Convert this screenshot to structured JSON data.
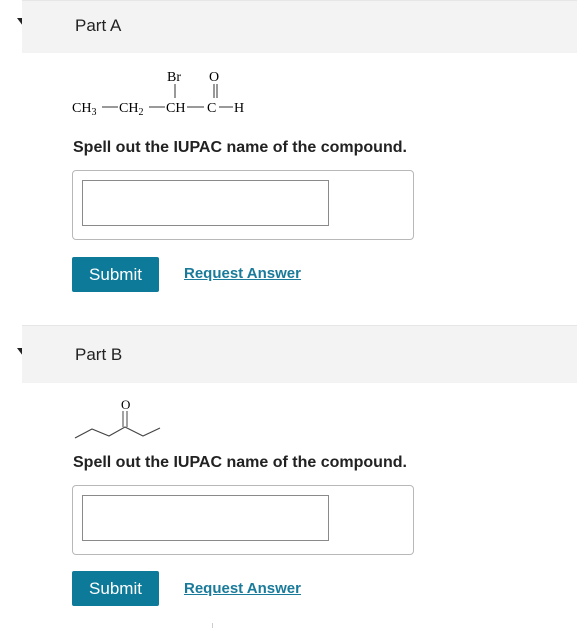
{
  "parts": [
    {
      "title": "Part A",
      "structure_labels": {
        "br": "Br",
        "o": "O",
        "ch3": "CH",
        "ch3_sub": "3",
        "ch2": "CH",
        "ch2_sub": "2",
        "ch": "CH",
        "c": "C",
        "h": "H"
      },
      "prompt": "Spell out the IUPAC name of the compound.",
      "input_value": "",
      "submit_label": "Submit",
      "request_label": "Request Answer"
    },
    {
      "title": "Part B",
      "structure_labels": {
        "o": "O"
      },
      "prompt": "Spell out the IUPAC name of the compound.",
      "input_value": "",
      "submit_label": "Submit",
      "request_label": "Request Answer"
    }
  ],
  "colors": {
    "accent": "#0d7a9a",
    "link": "#1a7a9a",
    "header_bg": "#f3f3f3"
  },
  "icons": {
    "collapse": "caret-down-icon"
  }
}
